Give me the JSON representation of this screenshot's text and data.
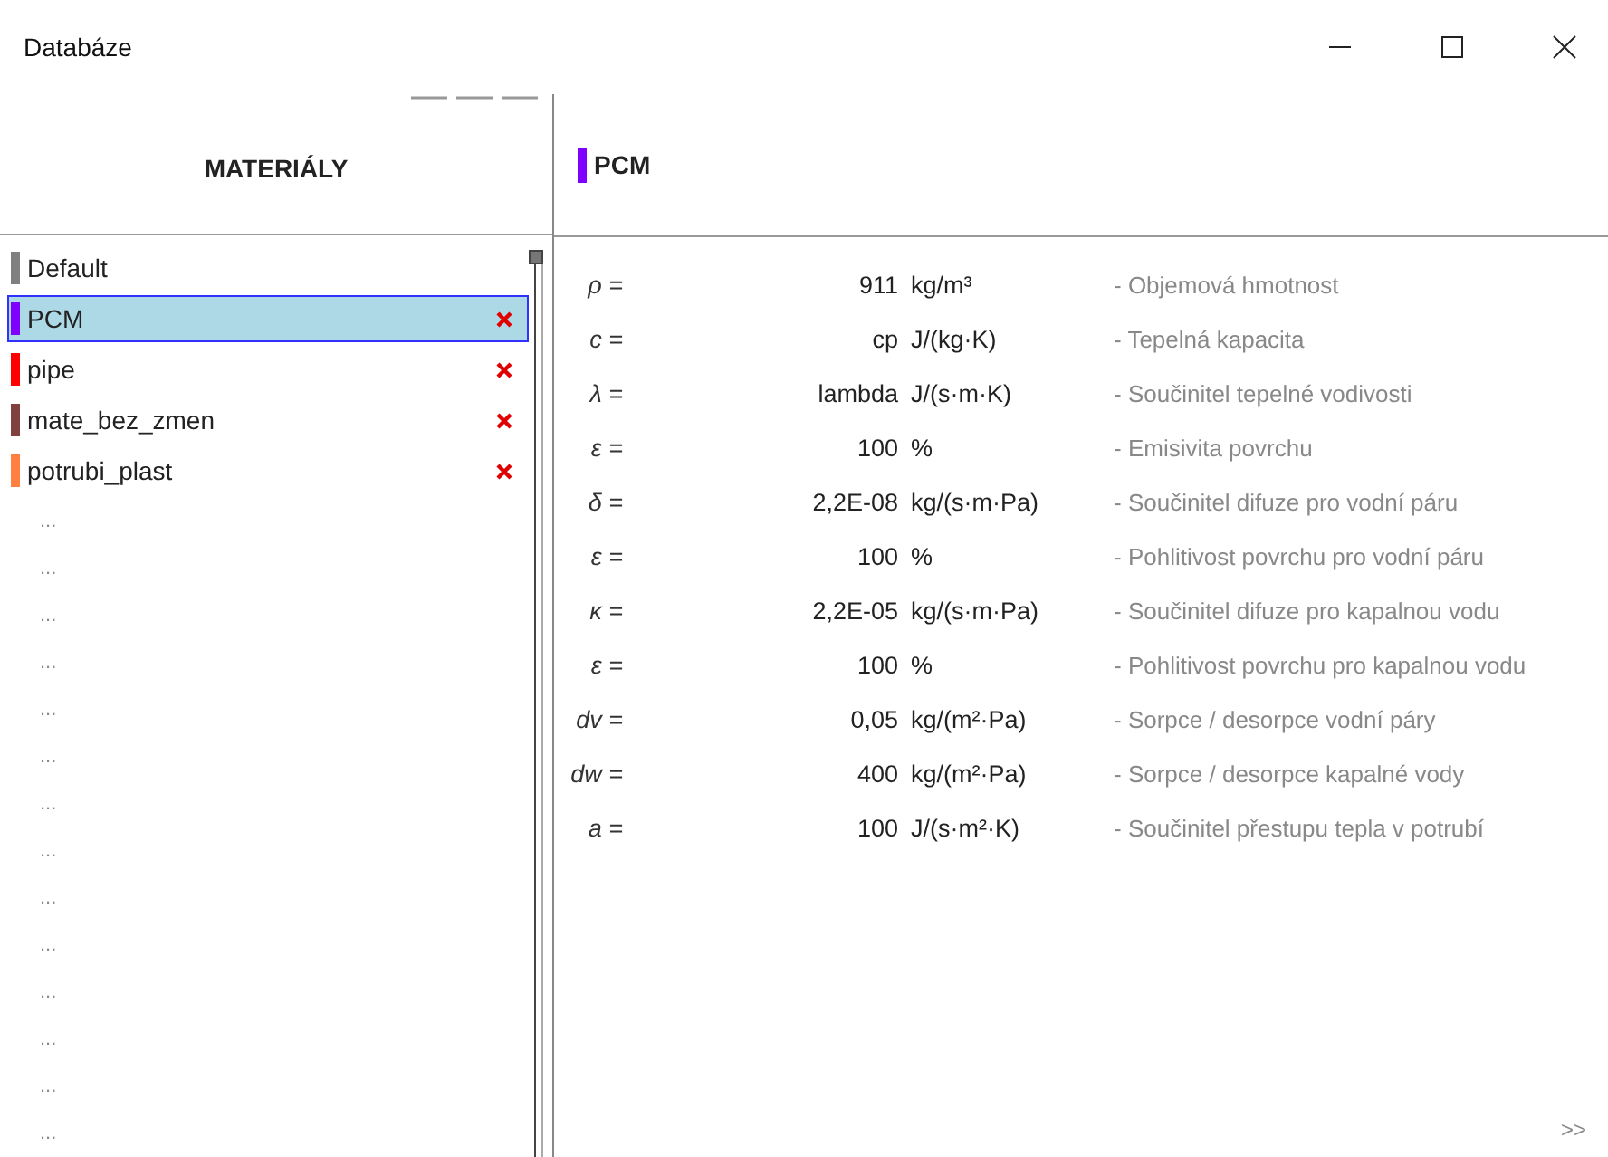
{
  "window": {
    "title": "Databáze"
  },
  "sidebar": {
    "title": "MATERIÁLY",
    "items": [
      {
        "name": "Default",
        "color": "#808080",
        "selected": false,
        "deletable": false
      },
      {
        "name": "PCM",
        "color": "#8000ff",
        "selected": true,
        "deletable": true
      },
      {
        "name": "pipe",
        "color": "#ff0000",
        "selected": false,
        "deletable": true
      },
      {
        "name": "mate_bez_zmen",
        "color": "#804040",
        "selected": false,
        "deletable": true
      },
      {
        "name": "potrubi_plast",
        "color": "#ff8040",
        "selected": false,
        "deletable": true
      }
    ],
    "empty_slots": [
      "...",
      "...",
      "...",
      "...",
      "...",
      "...",
      "...",
      "...",
      "...",
      "...",
      "...",
      "...",
      "...",
      "..."
    ]
  },
  "detail": {
    "title": "PCM",
    "color": "#8000ff",
    "properties": [
      {
        "symbol": "ρ =",
        "value": "911",
        "unit": "kg/m³",
        "description": "- Objemová hmotnost"
      },
      {
        "symbol": "c =",
        "value": "cp",
        "unit": "J/(kg·K)",
        "description": "- Tepelná kapacita"
      },
      {
        "symbol": "λ =",
        "value": "lambda",
        "unit": "J/(s·m·K)",
        "description": "- Součinitel tepelné vodivosti"
      },
      {
        "symbol": "ε =",
        "value": "100",
        "unit": "%",
        "description": "- Emisivita povrchu"
      },
      {
        "symbol": "δ =",
        "value": "2,2E-08",
        "unit": "kg/(s·m·Pa)",
        "description": "- Součinitel difuze pro vodní páru"
      },
      {
        "symbol": "ε =",
        "value": "100",
        "unit": "%",
        "description": "- Pohlitivost povrchu pro vodní páru"
      },
      {
        "symbol": "κ =",
        "value": "2,2E-05",
        "unit": "kg/(s·m·Pa)",
        "description": "- Součinitel difuze pro kapalnou vodu"
      },
      {
        "symbol": "ε =",
        "value": "100",
        "unit": "%",
        "description": "- Pohlitivost povrchu pro kapalnou vodu"
      },
      {
        "symbol": "dv =",
        "value": "0,05",
        "unit": "kg/(m²·Pa)",
        "description": "- Sorpce / desorpce vodní páry"
      },
      {
        "symbol": "dw =",
        "value": "400",
        "unit": "kg/(m²·Pa)",
        "description": "- Sorpce / desorpce kapalné vody"
      },
      {
        "symbol": "a =",
        "value": "100",
        "unit": "J/(s·m²·K)",
        "description": "- Součinitel přestupu tepla v potrubí"
      }
    ],
    "more_button": ">>"
  }
}
